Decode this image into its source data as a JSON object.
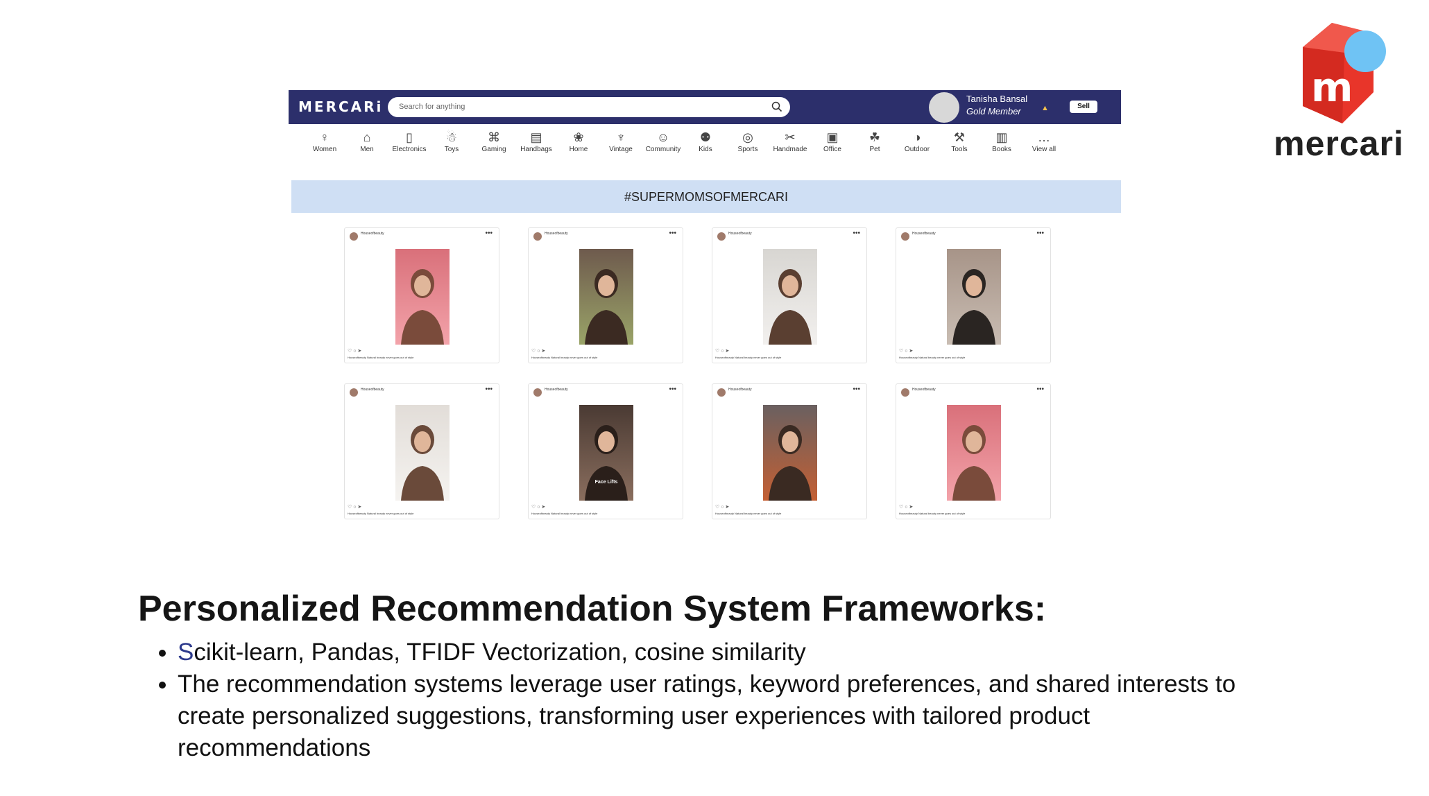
{
  "app": {
    "brand": "MERCARi",
    "search": {
      "placeholder": "Search for anything"
    },
    "user": {
      "name": "Tanisha Bansal",
      "tier": "Gold Member"
    },
    "sell_label": "Sell",
    "categories": [
      {
        "label": "Women",
        "icon": "dress-icon"
      },
      {
        "label": "Men",
        "icon": "tshirt-icon"
      },
      {
        "label": "Electronics",
        "icon": "phone-icon"
      },
      {
        "label": "Toys",
        "icon": "robot-icon"
      },
      {
        "label": "Gaming",
        "icon": "gamepad-icon"
      },
      {
        "label": "Handbags",
        "icon": "handbag-icon"
      },
      {
        "label": "Home",
        "icon": "lamp-icon"
      },
      {
        "label": "Vintage",
        "icon": "trophy-icon"
      },
      {
        "label": "Community",
        "icon": "people-icon"
      },
      {
        "label": "Kids",
        "icon": "toy-icon"
      },
      {
        "label": "Sports",
        "icon": "ball-icon"
      },
      {
        "label": "Handmade",
        "icon": "craft-icon"
      },
      {
        "label": "Office",
        "icon": "clipboard-icon"
      },
      {
        "label": "Pet",
        "icon": "cat-icon"
      },
      {
        "label": "Outdoor",
        "icon": "tent-icon"
      },
      {
        "label": "Tools",
        "icon": "drill-icon"
      },
      {
        "label": "Books",
        "icon": "book-icon"
      },
      {
        "label": "View all",
        "icon": "more-icon"
      }
    ],
    "banner": "#SUPERMOMSOFMERCARI",
    "posts": [
      {
        "user": "Houseofbeauty",
        "caption": "Houseofbeauty  Natural beauty never goes out of style",
        "overlay": ""
      },
      {
        "user": "Houseofbeauty",
        "caption": "Houseofbeauty  Natural beauty never goes out of style",
        "overlay": ""
      },
      {
        "user": "Houseofbeauty",
        "caption": "Houseofbeauty  Natural beauty never goes out of style",
        "overlay": ""
      },
      {
        "user": "Houseofbeauty",
        "caption": "Houseofbeauty  Natural beauty never goes out of style",
        "overlay": ""
      },
      {
        "user": "Houseofbeauty",
        "caption": "Houseofbeauty  Natural beauty never goes out of style",
        "overlay": ""
      },
      {
        "user": "Houseofbeauty",
        "caption": "Houseofbeauty  Natural beauty never goes out of style",
        "overlay": "Face Lifts"
      },
      {
        "user": "Houseofbeauty",
        "caption": "Houseofbeauty  Natural beauty never goes out of style",
        "overlay": ""
      },
      {
        "user": "Houseofbeauty",
        "caption": "Houseofbeauty  Natural beauty never goes out of style",
        "overlay": ""
      }
    ]
  },
  "slide": {
    "heading": "Personalized Recommendation System Frameworks:",
    "bullets": [
      {
        "accent": "S",
        "text": "cikit-learn, Pandas, TFIDF Vectorization, cosine similarity"
      },
      {
        "accent": "",
        "text": "The recommendation systems leverage user ratings, keyword preferences, and shared interests to create personalized suggestions, transforming user experiences with tailored product recommendations"
      }
    ],
    "logo_word": "mercari",
    "logo_letter": "m"
  },
  "colors": {
    "navbar": "#2c2f6b",
    "banner": "#cfdff4",
    "logo_red": "#e8352a",
    "logo_blue": "#6fc3f4"
  }
}
